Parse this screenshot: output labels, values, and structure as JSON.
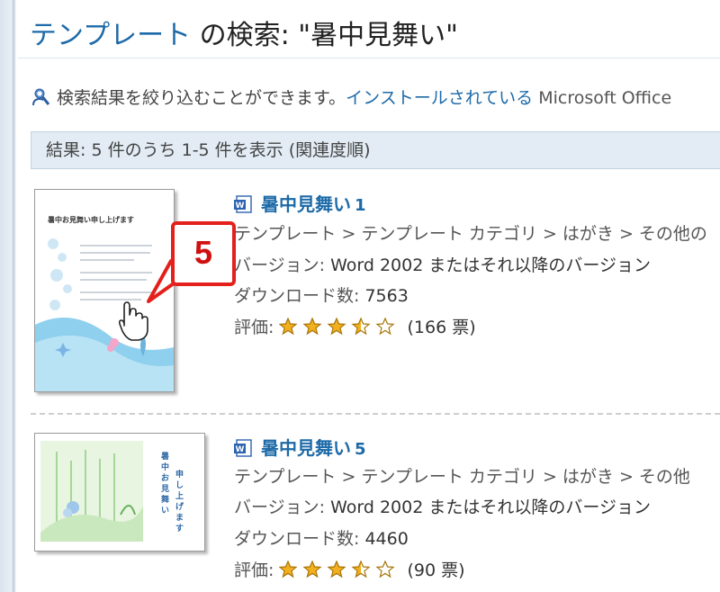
{
  "header": {
    "link_text": "テンプレート",
    "rest_text": " の検索: \"暑中見舞い\""
  },
  "filter": {
    "icon": "search-person-icon",
    "text": "検索結果を絞り込むことができます。",
    "link_text": "インストールされている",
    "product_text": " Microsoft Office"
  },
  "results_bar": {
    "text": "結果: 5 件のうち 1-5 件を表示 (関連度順)"
  },
  "results": [
    {
      "title": "暑中見舞い",
      "number": "1",
      "breadcrumb": "テンプレート > テンプレート カテゴリ > はがき > その他の",
      "version_label": "バージョン:",
      "version_value": " Word 2002 またはそれ以降のバージョン",
      "downloads_label": "ダウンロード数:",
      "downloads_value": " 7563",
      "rating_label": "評価:",
      "rating": 3.5,
      "votes": "(166 票)",
      "thumb_heading": "暑中お見舞い申し上げます"
    },
    {
      "title": "暑中見舞い",
      "number": "5",
      "breadcrumb": "テンプレート > テンプレート カテゴリ > はがき > その他",
      "version_label": "バージョン:",
      "version_value": " Word 2002 またはそれ以降のバージョン",
      "downloads_label": "ダウンロード数:",
      "downloads_value": " 4460",
      "rating_label": "評価:",
      "rating": 3.5,
      "votes": "(90 票)",
      "thumb_heading": "暑中お見舞い申し上げます"
    }
  ],
  "callout": {
    "number": "5"
  },
  "colors": {
    "link": "#1d6aa8",
    "accent_red": "#e3201b",
    "star": "#f2b01e"
  }
}
